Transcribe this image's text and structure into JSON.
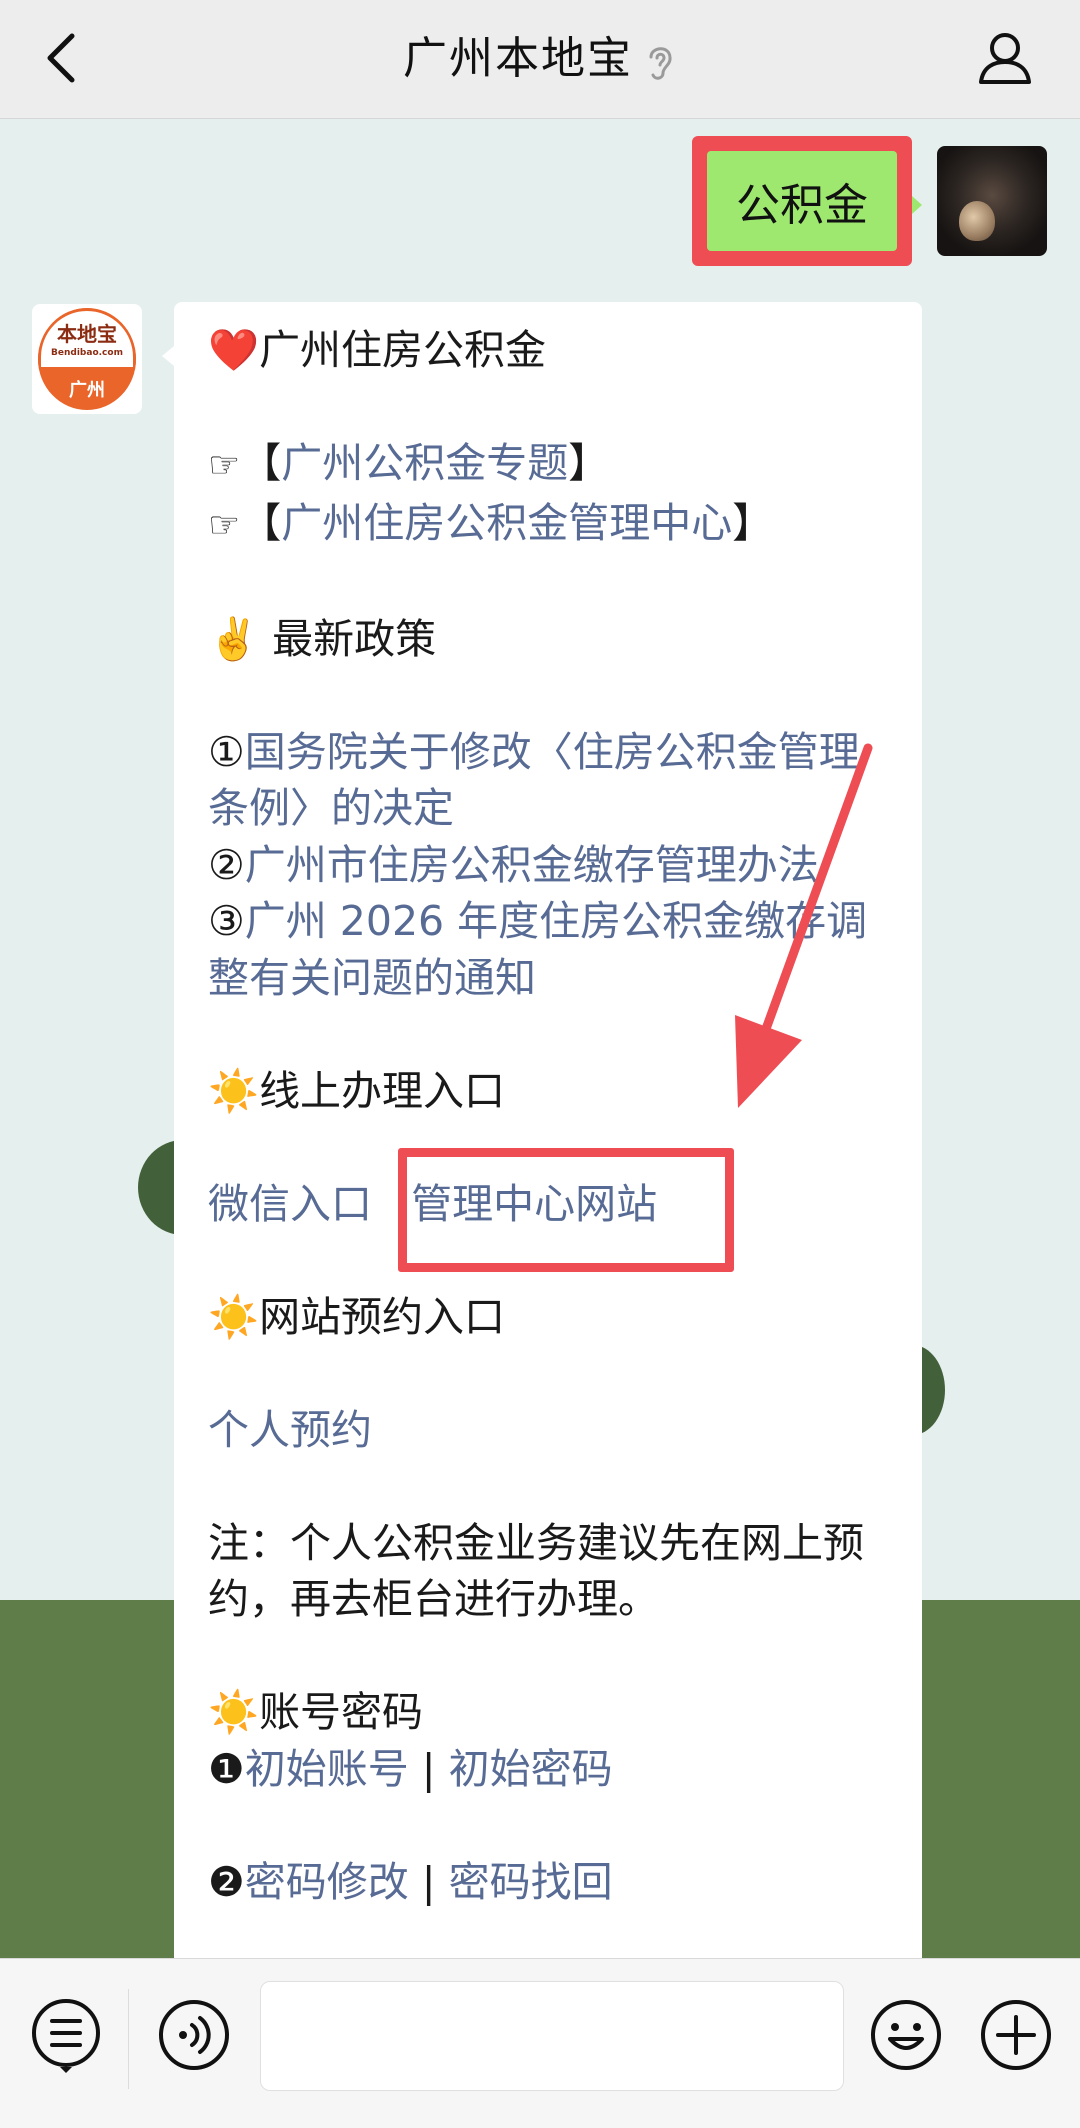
{
  "header": {
    "title": "广州本地宝"
  },
  "sent_message": {
    "text": "公积金"
  },
  "bot": {
    "logo_text": "本地宝",
    "logo_sub": "Bendibao.com",
    "logo_city": "广州"
  },
  "message": {
    "title_emoji": "❤️",
    "title": "广州住房公积金",
    "pointer": "☞",
    "links_top": [
      {
        "open": "【",
        "text": "广州公积金专题",
        "close": "】"
      },
      {
        "open": "【",
        "text": "广州住房公积金管理中心",
        "close": "】"
      }
    ],
    "policy_emoji": "✌️",
    "policy_heading": "最新政策",
    "policies": [
      {
        "num": "①",
        "text": "国务院关于修改〈住房公积金管理条例〉的决定"
      },
      {
        "num": "②",
        "text": "广州市住房公积金缴存管理办法"
      },
      {
        "num": "③",
        "text": "广州 2026 年度住房公积金缴存调整有关问题的通知"
      }
    ],
    "sun_emoji": "☀️",
    "online_heading": "线上办理入口",
    "online_links": [
      "微信入口",
      "管理中心网站"
    ],
    "booking_heading": "网站预约入口",
    "booking_link": "个人预约",
    "note": "注：个人公积金业务建议先在网上预约，再去柜台进行办理。",
    "account_heading": "账号密码",
    "account_rows": [
      {
        "num": "❶",
        "a": "初始账号",
        "sep": " | ",
        "b": "初始密码"
      },
      {
        "num": "❷",
        "a": "密码修改",
        "sep": " | ",
        "b": "密码找回"
      }
    ]
  },
  "colors": {
    "accent_red": "#ee4d54",
    "link": "#576b95",
    "sent_bubble": "#9ee870"
  },
  "icons": [
    "back-icon",
    "ear-icon",
    "profile-icon",
    "menu-icon",
    "voice-icon",
    "emoji-icon",
    "plus-icon"
  ]
}
